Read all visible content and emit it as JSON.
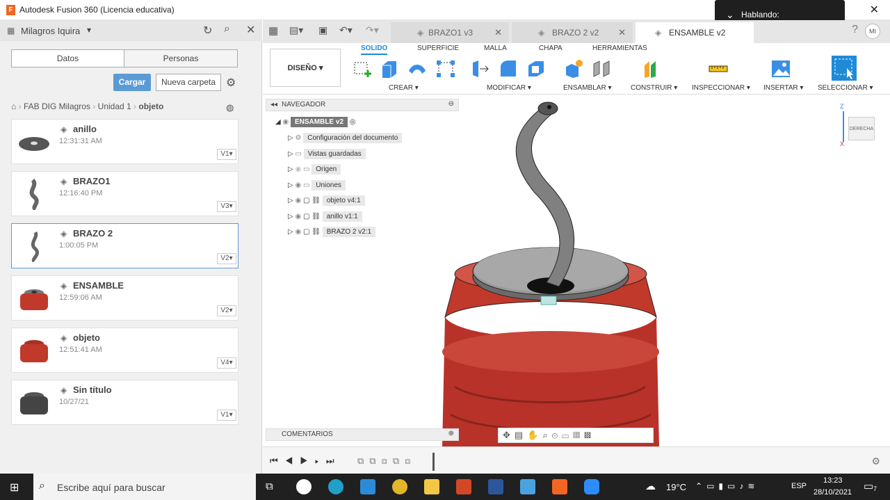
{
  "window": {
    "title": "Autodesk Fusion 360 (Licencia educativa)",
    "close_glyph": "✕"
  },
  "notification": {
    "text": "Hablando:"
  },
  "left_panel": {
    "user": "Milagros Iquira",
    "tabs": [
      "Datos",
      "Personas"
    ],
    "upload_label": "Cargar",
    "new_folder_label": "Nueva carpeta",
    "breadcrumb": [
      "FAB DIG Milagros",
      "Unidad 1",
      "objeto"
    ],
    "files": [
      {
        "name": "anillo",
        "time": "12:31:31 AM",
        "version": "V1"
      },
      {
        "name": "BRAZO1",
        "time": "12:16:40 PM",
        "version": "V3"
      },
      {
        "name": "BRAZO 2",
        "time": "1:00:05 PM",
        "version": "V2"
      },
      {
        "name": "ENSAMBLE",
        "time": "12:59:06 AM",
        "version": "V2"
      },
      {
        "name": "objeto",
        "time": "12:51:41 AM",
        "version": "V4"
      },
      {
        "name": "Sin título",
        "time": "10/27/21",
        "version": "V1"
      }
    ]
  },
  "doc_tabs": [
    {
      "label": "BRAZO1 v3"
    },
    {
      "label": "BRAZO 2 v2"
    },
    {
      "label": "ENSAMBLE v2"
    }
  ],
  "ribbon": {
    "workspace": "DISEÑO",
    "tabs": [
      "SOLIDO",
      "SUPERFICIE",
      "MALLA",
      "CHAPA",
      "HERRAMIENTAS"
    ],
    "groups": [
      "CREAR",
      "MODIFICAR",
      "ENSAMBLAR",
      "CONSTRUIR",
      "INSPECCIONAR",
      "INSERTAR",
      "SELECCIONAR"
    ]
  },
  "navigator": {
    "title": "NAVEGADOR",
    "root": "ENSAMBLE v2",
    "items": [
      "Configuración del documento",
      "Vistas guardadas",
      "Origen",
      "Uniones",
      "objeto v4:1",
      "anillo v1:1",
      "BRAZO 2 v2:1"
    ]
  },
  "viewcube_label": "DERECHA",
  "comments_label": "COMENTARIOS",
  "taskbar": {
    "search_placeholder": "Escribe aquí para buscar",
    "weather": "19°C",
    "lang": "ESP",
    "time": "13:23",
    "date": "28/10/2021",
    "notif_count": "7"
  },
  "colors": {
    "accent": "#1f8ad8",
    "model_red": "#c0392b",
    "upload_btn": "#5b9bd5"
  }
}
